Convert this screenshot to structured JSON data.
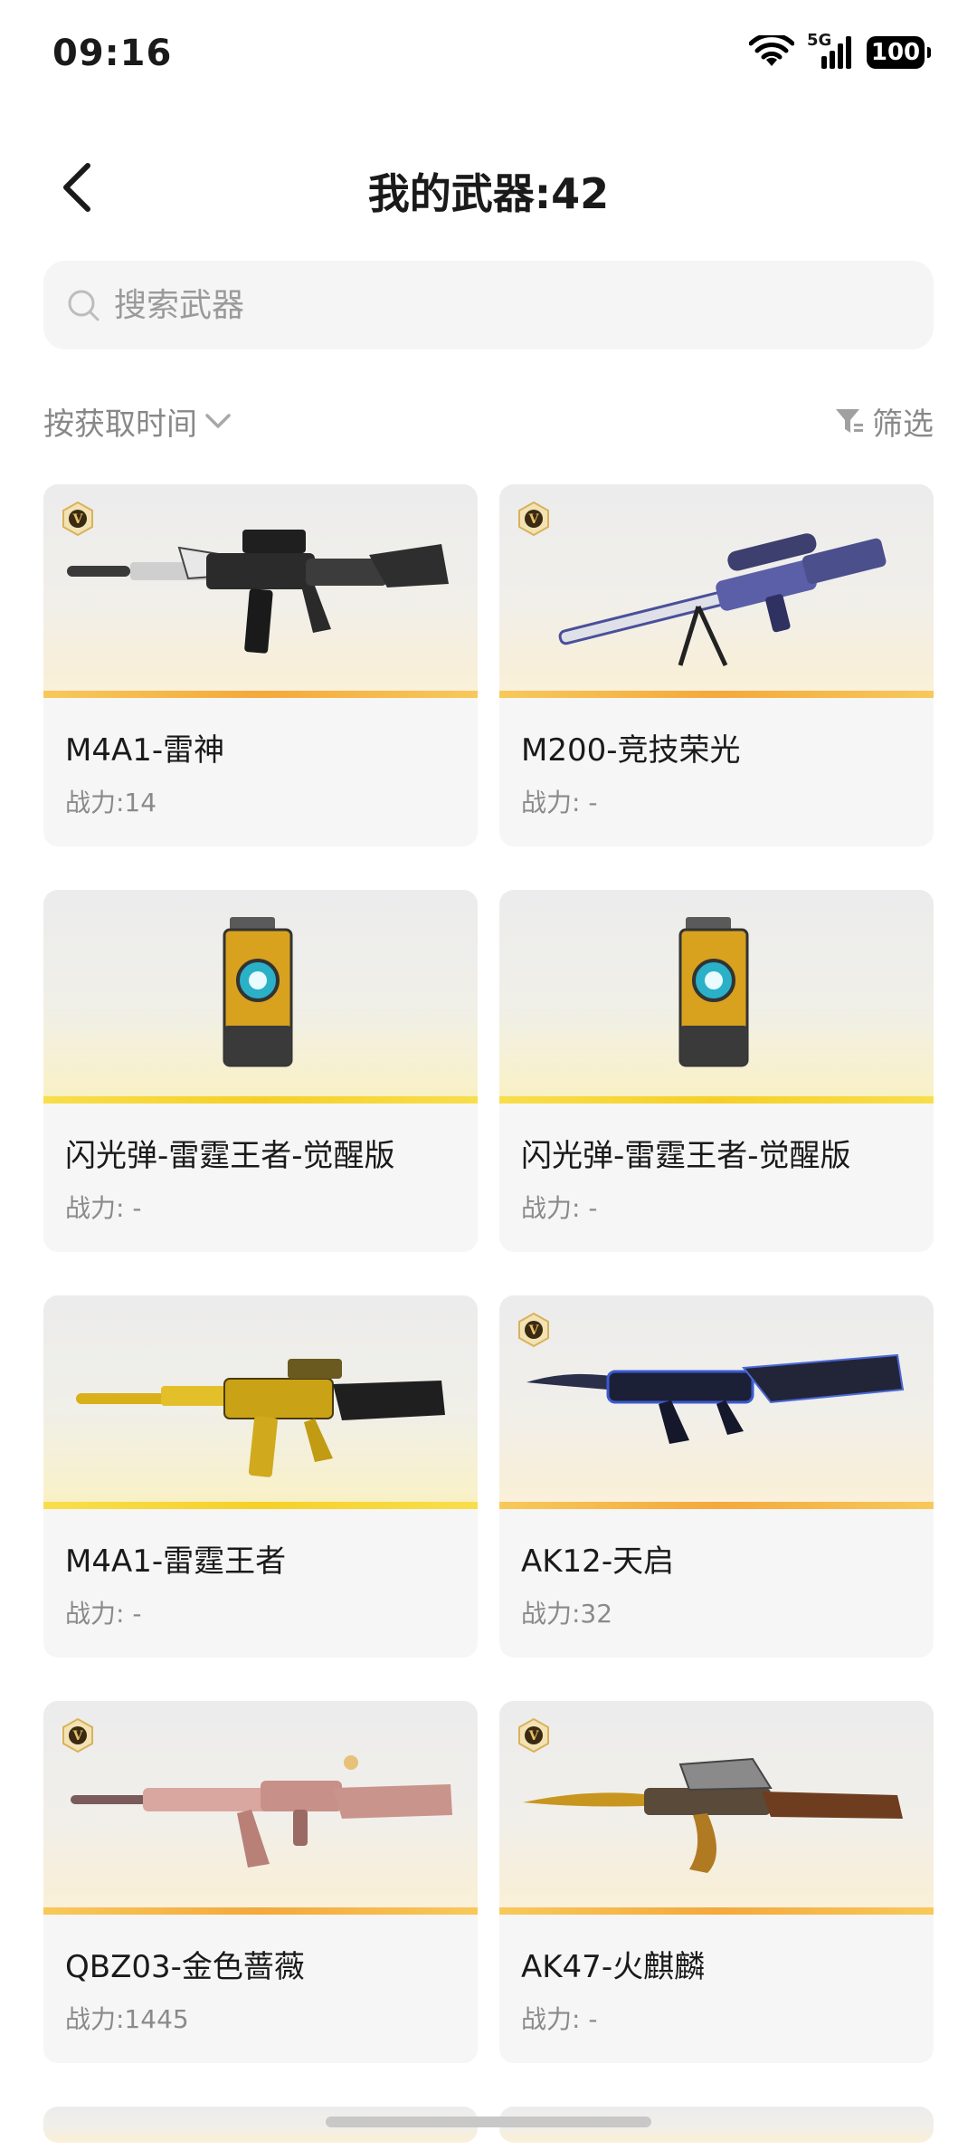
{
  "status_bar": {
    "time": "09:16",
    "network": "5G",
    "battery": "100"
  },
  "header": {
    "title": "我的武器:42"
  },
  "search": {
    "placeholder": "搜索武器"
  },
  "sort": {
    "label": "按获取时间"
  },
  "filter": {
    "label": "筛选"
  },
  "weapons": [
    {
      "name": "M4A1-雷神",
      "power": "战力:14",
      "vip": true
    },
    {
      "name": "M200-竞技荣光",
      "power": "战力: -",
      "vip": true
    },
    {
      "name": "闪光弹-雷霆王者-觉醒版",
      "power": "战力: -",
      "vip": false
    },
    {
      "name": "闪光弹-雷霆王者-觉醒版",
      "power": "战力: -",
      "vip": false
    },
    {
      "name": "M4A1-雷霆王者",
      "power": "战力: -",
      "vip": false
    },
    {
      "name": "AK12-天启",
      "power": "战力:32",
      "vip": true
    },
    {
      "name": "QBZ03-金色蔷薇",
      "power": "战力:1445",
      "vip": true
    },
    {
      "name": "AK47-火麒麟",
      "power": "战力: -",
      "vip": true
    }
  ],
  "colors": {
    "accent_gold": "#f4a93b",
    "flash_yellow": "#f6d028",
    "text_secondary": "#8a8a8a"
  }
}
